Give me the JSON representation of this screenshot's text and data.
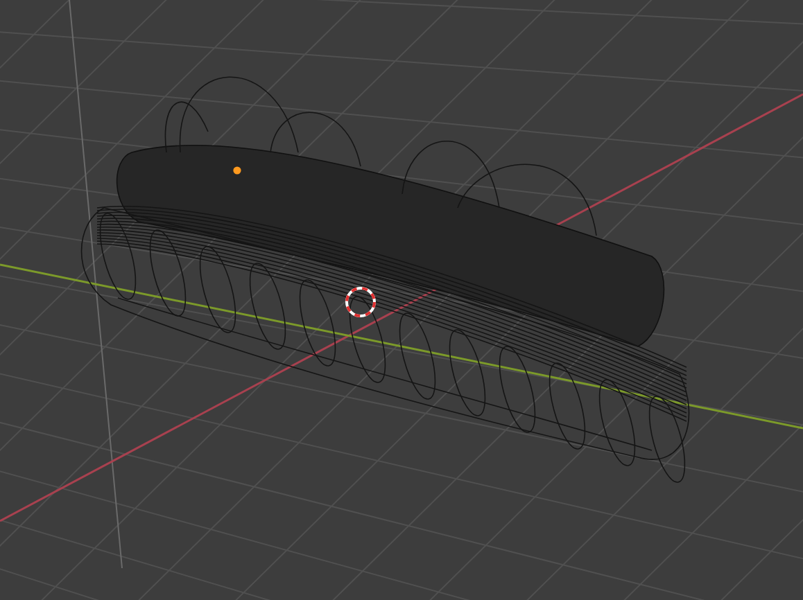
{
  "viewport": {
    "grid": true,
    "axes": true,
    "cursor": true,
    "origin": true
  }
}
